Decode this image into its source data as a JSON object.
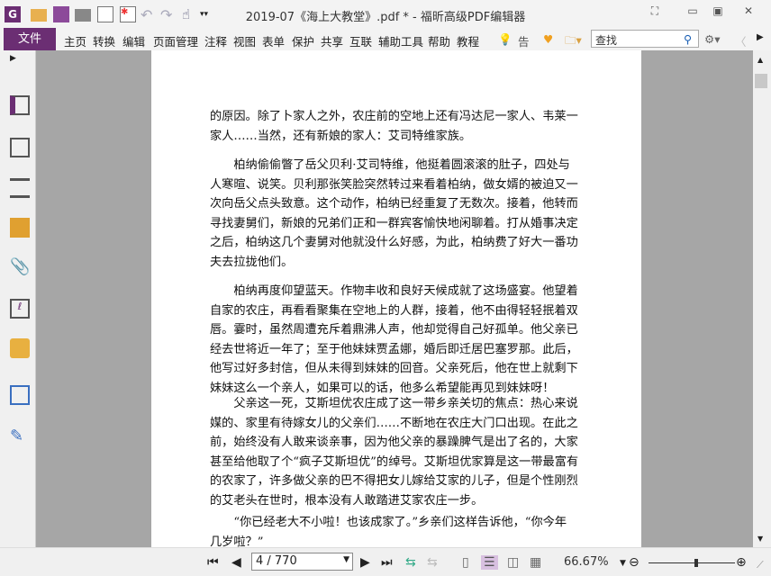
{
  "window": {
    "title": "2019-07《海上大教堂》.pdf * - 福昕高级PDF编辑器"
  },
  "menu": {
    "file": "文件",
    "items": [
      "主页",
      "转换",
      "编辑",
      "页面管理",
      "注释",
      "视图",
      "表单",
      "保护",
      "共享",
      "互联",
      "辅助工具",
      "帮助",
      "教程"
    ],
    "tell": "告诉",
    "search_placeholder": "查找"
  },
  "document": {
    "paragraphs": [
      [
        "的原因。除了卜家人之外，农庄前的空地上还有冯达尼一家人、韦莱一",
        "家人……当然，还有新娘的家人：艾司特维家族。"
      ],
      [
        "　　柏纳偷偷瞥了岳父贝利·艾司特维，他挺着圆滚滚的肚子，四处与",
        "人寒暄、说笑。贝利那张笑脸突然转过来看着柏纳，做女婿的被迫又一",
        "次向岳父点头致意。这个动作，柏纳已经重复了无数次。接着，他转而",
        "寻找妻舅们，新娘的兄弟们正和一群宾客愉快地闲聊着。打从婚事决定",
        "之后，柏纳这几个妻舅对他就没什么好感，为此，柏纳费了好大一番功",
        "夫去拉拢他们。"
      ],
      [
        "　　柏纳再度仰望蓝天。作物丰收和良好天候成就了这场盛宴。他望着",
        "自家的农庄，再看看聚集在空地上的人群，接着，他不由得轻轻抿着双",
        "唇。霎时，虽然周遭充斥着鼎沸人声，他却觉得自己好孤单。他父亲已",
        "经去世将近一年了；至于他妹妹贾孟娜，婚后即迁居巴塞罗那。此后，",
        "他写过好多封信，但从未得到妹妹的回音。父亲死后，他在世上就剩下",
        "妹妹这么一个亲人，如果可以的话，他多么希望能再见到妹妹呀！"
      ],
      [
        "　　父亲这一死，艾斯坦优农庄成了这一带乡亲关切的焦点：热心来说",
        "媒的、家里有待嫁女儿的父亲们……不断地在农庄大门口出现。在此之",
        "前，始终没有人敢来谈亲事，因为他父亲的暴躁脾气是出了名的，大家",
        "甚至给他取了个“疯子艾斯坦优”的绰号。艾斯坦优家算是这一带最富有",
        "的农家了，许多做父亲的巴不得把女儿嫁给艾家的儿子，但是个性刚烈",
        "的艾老头在世时，根本没有人敢踏进艾家农庄一步。"
      ],
      [
        "　　“你已经老大不小啦！也该成家了。”乡亲们这样告诉他，“你今年",
        "几岁啦？”"
      ]
    ]
  },
  "status": {
    "page": "4 / 770",
    "zoom": "66.67%",
    "zoom_level": 0.55
  },
  "colors": {
    "accent": "#6b2e73"
  }
}
